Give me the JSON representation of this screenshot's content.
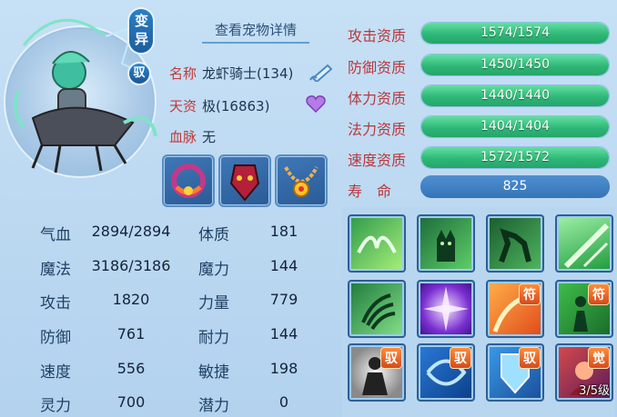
{
  "header": {
    "view_detail": "查看宠物详情"
  },
  "badges": {
    "variant": "变异",
    "yu": "驭"
  },
  "info": {
    "name_key": "名称",
    "name_val": "龙虾骑士(134)",
    "talent_key": "天资",
    "talent_val": "极(16863)",
    "blood_key": "血脉",
    "blood_val": "无"
  },
  "equipment": [
    {
      "icon": "dragon-collar-icon"
    },
    {
      "icon": "mask-amulet-icon"
    },
    {
      "icon": "bead-necklace-icon"
    }
  ],
  "stats": [
    {
      "k": "气血",
      "v": "2894/2894",
      "k2": "体质",
      "v2": "181"
    },
    {
      "k": "魔法",
      "v": "3186/3186",
      "k2": "魔力",
      "v2": "144"
    },
    {
      "k": "攻击",
      "v": "1820",
      "k2": "力量",
      "v2": "779"
    },
    {
      "k": "防御",
      "v": "761",
      "k2": "耐力",
      "v2": "144"
    },
    {
      "k": "速度",
      "v": "556",
      "k2": "敏捷",
      "v2": "198"
    },
    {
      "k": "灵力",
      "v": "700",
      "k2": "潜力",
      "v2": "0"
    }
  ],
  "aptitudes": [
    {
      "label": "攻击资质",
      "value": "1574/1574",
      "fill": 1.0
    },
    {
      "label": "防御资质",
      "value": "1450/1450",
      "fill": 1.0
    },
    {
      "label": "体力资质",
      "value": "1440/1440",
      "fill": 1.0
    },
    {
      "label": "法力资质",
      "value": "1404/1404",
      "fill": 1.0
    },
    {
      "label": "速度资质",
      "value": "1572/1572",
      "fill": 1.0
    }
  ],
  "life": {
    "label": "寿　命",
    "value": "825"
  },
  "skills": [
    {
      "icon": "wings-skill-icon",
      "tag": ""
    },
    {
      "icon": "ghost-cat-skill-icon",
      "tag": ""
    },
    {
      "icon": "horse-skill-icon",
      "tag": ""
    },
    {
      "icon": "green-light-skill-icon",
      "tag": ""
    },
    {
      "icon": "claw-hand-skill-icon",
      "tag": ""
    },
    {
      "icon": "purple-burst-skill-icon",
      "tag": ""
    },
    {
      "icon": "fire-arc-skill-icon",
      "tag": "符"
    },
    {
      "icon": "green-figure-skill-icon",
      "tag": "符"
    },
    {
      "icon": "shadow-figure-skill-icon",
      "tag": "驭"
    },
    {
      "icon": "blue-vortex-skill-icon",
      "tag": "驭"
    },
    {
      "icon": "blue-shield-skill-icon",
      "tag": "驭"
    },
    {
      "icon": "awaken-skill-icon",
      "tag": "觉",
      "level": "3/5级"
    }
  ],
  "colors": {
    "accent_green": "#2eb878",
    "label_red": "#b8383f",
    "border_blue": "#2d5f95"
  }
}
